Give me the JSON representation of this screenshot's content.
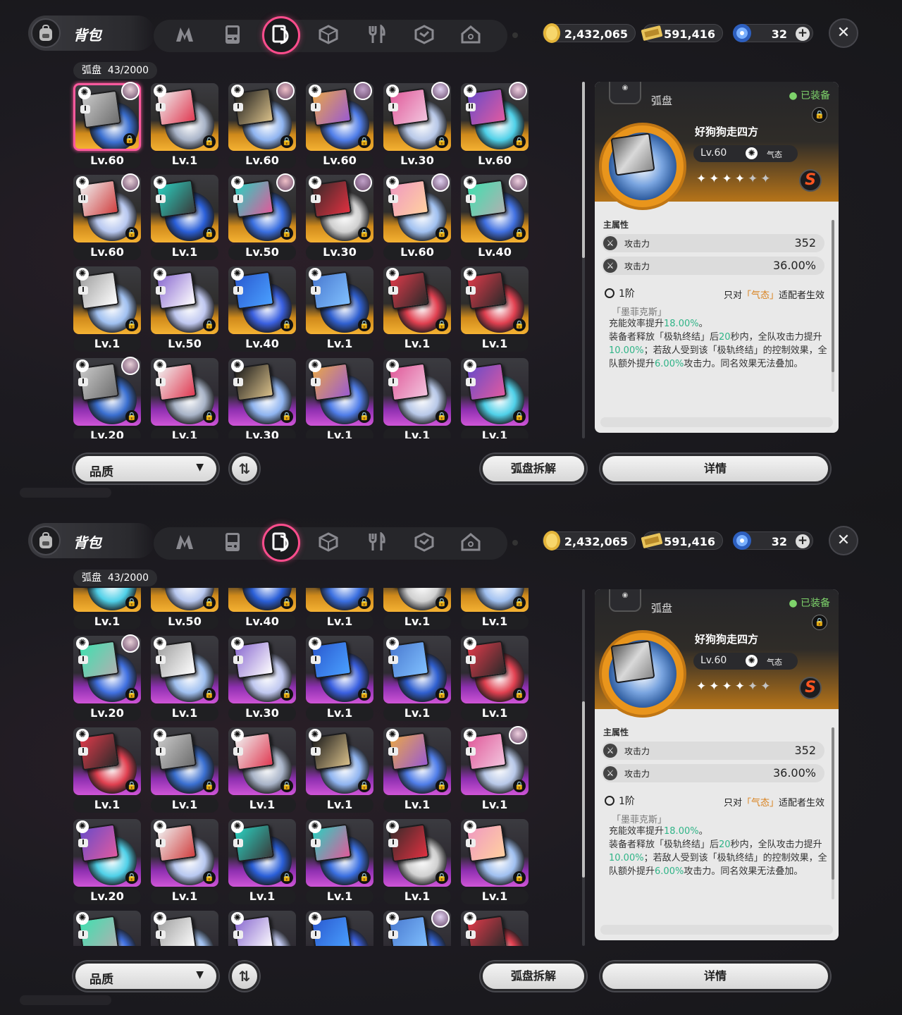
{
  "top": {
    "bag_title": "背包",
    "tabs": [
      {
        "icon": "n-logo-icon"
      },
      {
        "icon": "gameboy-icon"
      },
      {
        "icon": "disc-icon",
        "active": true
      },
      {
        "icon": "cube-icon"
      },
      {
        "icon": "fork-spoon-icon"
      },
      {
        "icon": "hexagon-badge-icon"
      },
      {
        "icon": "house-icon"
      }
    ],
    "currencies": [
      {
        "icon": "gold-coin-icon",
        "value": "2,432,065"
      },
      {
        "icon": "ticket-icon",
        "value": "591,416"
      },
      {
        "icon": "energy-orb-icon",
        "value": "32"
      }
    ],
    "close_icon": "close-icon"
  },
  "inventory": {
    "label": "弧盘",
    "count": "43/2000"
  },
  "colors": {
    "quality_S": "#f4b233",
    "quality_A": "#cf55d7",
    "accent": "#ff4d8d",
    "equipped": "#7ed36b",
    "highlight_green": "#2fb487",
    "highlight_orange": "#d9801b"
  },
  "screens": [
    {
      "scroll_fraction": 0.0,
      "cells": [
        {
          "lv": "Lv.60",
          "q": "S",
          "tier": "I",
          "avatar": true,
          "sel": true
        },
        {
          "lv": "Lv.1",
          "q": "S",
          "tier": "I",
          "avatar": false
        },
        {
          "lv": "Lv.60",
          "q": "S",
          "tier": "I",
          "avatar": true
        },
        {
          "lv": "Lv.60",
          "q": "S",
          "tier": "I",
          "avatar": true
        },
        {
          "lv": "Lv.30",
          "q": "S",
          "tier": "I",
          "avatar": true
        },
        {
          "lv": "Lv.60",
          "q": "S",
          "tier": "II",
          "avatar": true
        },
        {
          "lv": "Lv.60",
          "q": "S",
          "tier": "II",
          "avatar": true
        },
        {
          "lv": "Lv.1",
          "q": "S",
          "tier": "I",
          "avatar": false
        },
        {
          "lv": "Lv.50",
          "q": "S",
          "tier": "I",
          "avatar": true
        },
        {
          "lv": "Lv.30",
          "q": "S",
          "tier": "I",
          "avatar": true
        },
        {
          "lv": "Lv.60",
          "q": "S",
          "tier": "I",
          "avatar": true
        },
        {
          "lv": "Lv.40",
          "q": "S",
          "tier": "I",
          "avatar": true
        },
        {
          "lv": "Lv.1",
          "q": "S",
          "tier": "I",
          "avatar": false
        },
        {
          "lv": "Lv.50",
          "q": "S",
          "tier": "I",
          "avatar": false
        },
        {
          "lv": "Lv.40",
          "q": "S",
          "tier": "I",
          "avatar": false
        },
        {
          "lv": "Lv.1",
          "q": "S",
          "tier": "I",
          "avatar": false
        },
        {
          "lv": "Lv.1",
          "q": "S",
          "tier": "I",
          "avatar": false
        },
        {
          "lv": "Lv.1",
          "q": "S",
          "tier": "I",
          "avatar": false
        },
        {
          "lv": "Lv.20",
          "q": "A",
          "tier": "I",
          "avatar": true
        },
        {
          "lv": "Lv.1",
          "q": "A",
          "tier": "I",
          "avatar": false
        },
        {
          "lv": "Lv.30",
          "q": "A",
          "tier": "I",
          "avatar": false
        },
        {
          "lv": "Lv.1",
          "q": "A",
          "tier": "I",
          "avatar": false
        },
        {
          "lv": "Lv.1",
          "q": "A",
          "tier": "I",
          "avatar": false
        },
        {
          "lv": "Lv.1",
          "q": "A",
          "tier": "I",
          "avatar": false
        }
      ]
    },
    {
      "scroll_fraction": 0.62,
      "cells": [
        {
          "lv": "Lv.1",
          "q": "S",
          "tier": "I",
          "avatar": false
        },
        {
          "lv": "Lv.50",
          "q": "S",
          "tier": "I",
          "avatar": false
        },
        {
          "lv": "Lv.40",
          "q": "S",
          "tier": "I",
          "avatar": false
        },
        {
          "lv": "Lv.1",
          "q": "S",
          "tier": "I",
          "avatar": false
        },
        {
          "lv": "Lv.1",
          "q": "S",
          "tier": "I",
          "avatar": false
        },
        {
          "lv": "Lv.1",
          "q": "S",
          "tier": "I",
          "avatar": false
        },
        {
          "lv": "Lv.20",
          "q": "A",
          "tier": "I",
          "avatar": true
        },
        {
          "lv": "Lv.1",
          "q": "A",
          "tier": "I",
          "avatar": false
        },
        {
          "lv": "Lv.30",
          "q": "A",
          "tier": "I",
          "avatar": false
        },
        {
          "lv": "Lv.1",
          "q": "A",
          "tier": "I",
          "avatar": false
        },
        {
          "lv": "Lv.1",
          "q": "A",
          "tier": "I",
          "avatar": false
        },
        {
          "lv": "Lv.1",
          "q": "A",
          "tier": "I",
          "avatar": false
        },
        {
          "lv": "Lv.1",
          "q": "A",
          "tier": "I",
          "avatar": false
        },
        {
          "lv": "Lv.1",
          "q": "A",
          "tier": "I",
          "avatar": false
        },
        {
          "lv": "Lv.1",
          "q": "A",
          "tier": "I",
          "avatar": false
        },
        {
          "lv": "Lv.1",
          "q": "A",
          "tier": "I",
          "avatar": false
        },
        {
          "lv": "Lv.1",
          "q": "A",
          "tier": "I",
          "avatar": false
        },
        {
          "lv": "Lv.1",
          "q": "A",
          "tier": "I",
          "avatar": true
        },
        {
          "lv": "Lv.20",
          "q": "A",
          "tier": "I",
          "avatar": false
        },
        {
          "lv": "Lv.1",
          "q": "A",
          "tier": "I",
          "avatar": false
        },
        {
          "lv": "Lv.1",
          "q": "A",
          "tier": "I",
          "avatar": false
        },
        {
          "lv": "Lv.1",
          "q": "A",
          "tier": "I",
          "avatar": false
        },
        {
          "lv": "Lv.1",
          "q": "A",
          "tier": "I",
          "avatar": false
        },
        {
          "lv": "Lv.1",
          "q": "A",
          "tier": "I",
          "avatar": false
        },
        {
          "lv": "",
          "q": "A",
          "tier": "I",
          "avatar": false
        },
        {
          "lv": "",
          "q": "A",
          "tier": "I",
          "avatar": false
        },
        {
          "lv": "",
          "q": "A",
          "tier": "I",
          "avatar": false
        },
        {
          "lv": "",
          "q": "A",
          "tier": "I",
          "avatar": false
        },
        {
          "lv": "",
          "q": "A",
          "tier": "I",
          "avatar": true
        },
        {
          "lv": "",
          "q": "A",
          "tier": "I",
          "avatar": false
        }
      ]
    }
  ],
  "detail": {
    "category": "弧盘",
    "equipped": "已装备",
    "disc_name": "好狗狗走四方",
    "level": "Lv.60",
    "attribute": "气态",
    "stars_filled": 4,
    "stars_total": 6,
    "rank_badge": "S",
    "main_stat_label": "主属性",
    "stats": [
      {
        "name": "攻击力",
        "value": "352"
      },
      {
        "name": "攻击力",
        "value": "36.00%"
      }
    ],
    "tier": "1阶",
    "restriction_pre": "只对",
    "restriction_attr": "「气态」",
    "restriction_post": "适配者生效",
    "effect_title": "「墨菲克斯」",
    "effect_segments": [
      {
        "t": "充能效率提升",
        "g": false
      },
      {
        "t": "18.00%",
        "g": true
      },
      {
        "t": "。\n装备者释放「极轨终结」后",
        "g": false
      },
      {
        "t": "20",
        "g": true
      },
      {
        "t": "秒内，全队攻击力提升",
        "g": false
      },
      {
        "t": "10.00%",
        "g": true
      },
      {
        "t": "；若敌人受到该「极轨终结」的控制效果，全队额外提升",
        "g": false
      },
      {
        "t": "6.00%",
        "g": true
      },
      {
        "t": "攻击力。同名效果无法叠加。",
        "g": false
      }
    ]
  },
  "footer": {
    "filter_label": "品质",
    "sort_icon": "sort-arrows-icon",
    "dismantle_label": "弧盘拆解",
    "details_label": "详情"
  }
}
